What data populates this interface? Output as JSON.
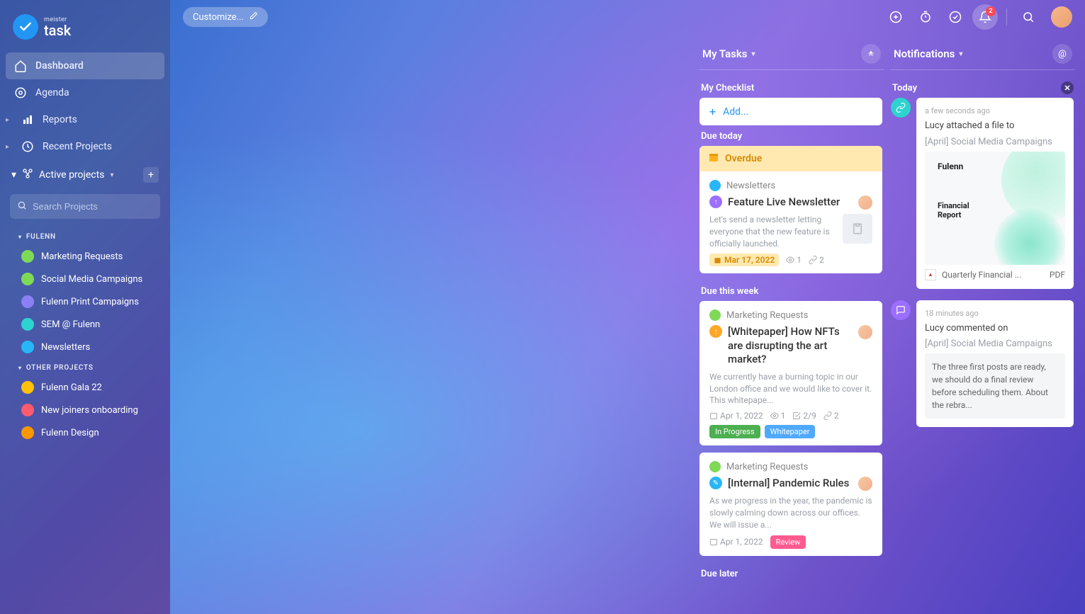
{
  "logo": {
    "meister": "meister",
    "task": "task"
  },
  "nav": {
    "dashboard": "Dashboard",
    "agenda": "Agenda",
    "reports": "Reports",
    "recent": "Recent Projects",
    "active": "Active projects"
  },
  "search": {
    "placeholder": "Search Projects"
  },
  "groups": {
    "fulenn": {
      "label": "FULENN",
      "items": [
        {
          "label": "Marketing Requests",
          "color": "#7ed957"
        },
        {
          "label": "Social Media Campaigns",
          "color": "#7ed957"
        },
        {
          "label": "Fulenn Print Campaigns",
          "color": "#8b7ff5"
        },
        {
          "label": "SEM @ Fulenn",
          "color": "#2dd4cf"
        },
        {
          "label": "Newsletters",
          "color": "#29b6f6"
        }
      ]
    },
    "other": {
      "label": "OTHER PROJECTS",
      "items": [
        {
          "label": "Fulenn Gala 22",
          "color": "#ffc107"
        },
        {
          "label": "New joiners onboarding",
          "color": "#ff5b6f"
        },
        {
          "label": "Fulenn Design",
          "color": "#ff9800"
        }
      ]
    }
  },
  "topbar": {
    "customize": "Customize...",
    "notif_count": "2"
  },
  "mytasks": {
    "title": "My Tasks",
    "checklist": "My Checklist",
    "add": "Add...",
    "due_today": "Due today",
    "due_week": "Due this week",
    "due_later": "Due later",
    "overdue": "Overdue"
  },
  "tasks": {
    "t1": {
      "project": "Newsletters",
      "title": "Feature Live Newsletter",
      "desc": "Let's send a newsletter letting everyone that the new feature is officially launched.",
      "date": "Mar 17, 2022",
      "watch": "1",
      "attach": "2"
    },
    "t2": {
      "project": "Marketing Requests",
      "title": "[Whitepaper] How NFTs are disrupting the art market?",
      "desc": "We currently have a burning topic in our London office and we would like to cover it. This whitepape...",
      "date": "Apr 1, 2022",
      "watch": "1",
      "check": "2/9",
      "attach": "2",
      "tag1": "In Progress",
      "tag2": "Whitepaper"
    },
    "t3": {
      "project": "Marketing Requests",
      "title": "[Internal] Pandemic Rules",
      "desc": "As we progress in the year, the pandemic is slowly calming down across our offices. We will issue a...",
      "date": "Apr 1, 2022",
      "tag": "Review"
    }
  },
  "notifications": {
    "title": "Notifications",
    "today": "Today",
    "n1": {
      "time": "a few seconds ago",
      "line1": "Lucy attached a file to",
      "line2": "[April] Social Media Campaigns",
      "preview_brand": "Fulenn",
      "preview_title1": "Financial",
      "preview_title2": "Report",
      "file": "Quarterly Financial ...",
      "filetype": "PDF"
    },
    "n2": {
      "time": "18 minutes ago",
      "line1": "Lucy commented on",
      "line2": "[April] Social Media Campaigns",
      "comment": "The three first posts are ready, we should do a final review before scheduling them. About the rebra..."
    }
  }
}
